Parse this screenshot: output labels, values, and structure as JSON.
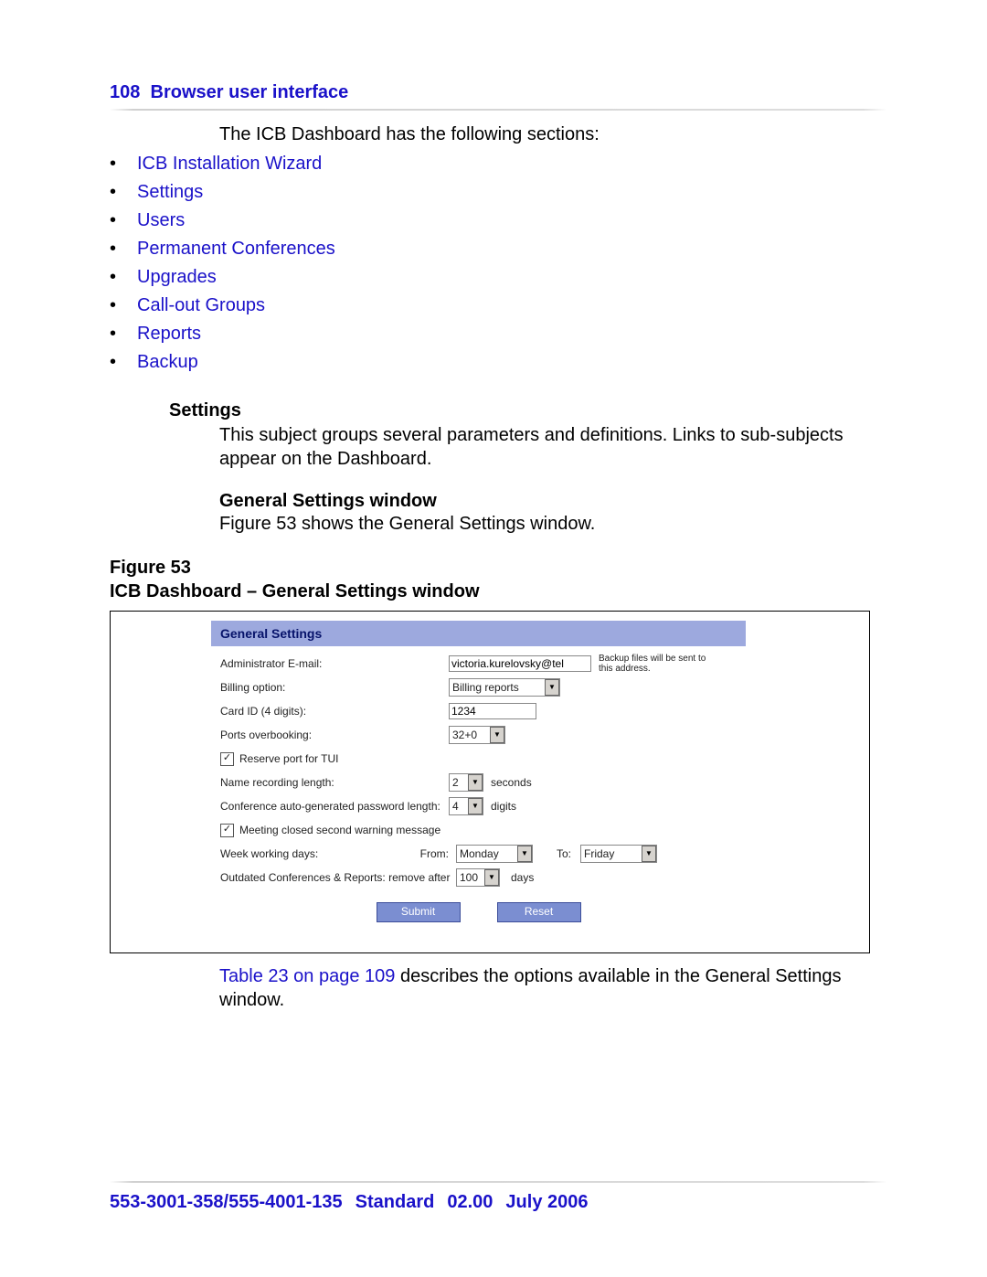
{
  "header": {
    "page_num": "108",
    "chapter": "Browser user interface"
  },
  "intro": "The ICB Dashboard has the following sections:",
  "bullets": [
    "ICB Installation Wizard",
    "Settings",
    "Users",
    "Permanent Conferences",
    "Upgrades",
    "Call-out Groups",
    "Reports",
    "Backup"
  ],
  "settings": {
    "heading": "Settings",
    "para": "This subject groups several parameters and definitions. Links to sub-subjects appear on the Dashboard."
  },
  "gsw": {
    "heading": "General Settings window",
    "para": "Figure 53 shows the General Settings window."
  },
  "figure": {
    "label_line1": "Figure 53",
    "label_line2": "ICB Dashboard – General Settings window",
    "title": "General Settings",
    "admin_email_label": "Administrator E-mail:",
    "admin_email_value": "victoria.kurelovsky@tel",
    "admin_email_note": "Backup files will be sent to this address.",
    "billing_label": "Billing option:",
    "billing_value": "Billing reports",
    "cardid_label": "Card ID (4 digits):",
    "cardid_value": "1234",
    "ports_label": "Ports overbooking:",
    "ports_value": "32+0",
    "reserve_label": "Reserve port for TUI",
    "namerec_label": "Name recording length:",
    "namerec_value": "2",
    "namerec_unit": "seconds",
    "pwlen_label": "Conference auto-generated password length:",
    "pwlen_value": "4",
    "pwlen_unit": "digits",
    "warn_label": "Meeting closed second warning message",
    "week_label": "Week working days:",
    "from_label": "From:",
    "from_value": "Monday",
    "to_label": "To:",
    "to_value": "Friday",
    "outdated_label": "Outdated Conferences & Reports: remove after",
    "outdated_value": "100",
    "outdated_unit": "days",
    "submit": "Submit",
    "reset": "Reset"
  },
  "after_fig": {
    "link": "Table 23 on page 109",
    "rest": " describes the options available in the General Settings window."
  },
  "footer": {
    "docnum": "553-3001-358/555-4001-135",
    "standard": "Standard",
    "rev": "02.00",
    "date": "July 2006"
  }
}
